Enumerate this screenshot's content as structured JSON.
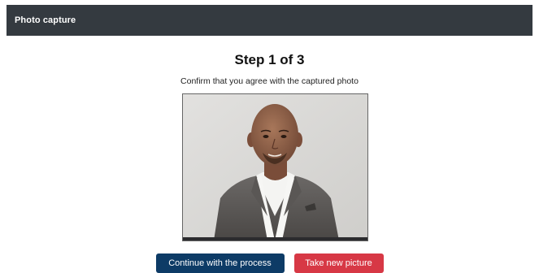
{
  "header": {
    "title": "Photo capture",
    "background_color": "#343a40"
  },
  "main": {
    "step_title": "Step 1 of 3",
    "instruction": "Confirm that you agree with the captured photo",
    "photo": {
      "subject": "captured-portrait-photo"
    }
  },
  "actions": {
    "continue_label": "Continue with the process",
    "continue_color": "#0d3b66",
    "retake_label": "Take new picture",
    "retake_color": "#d73845"
  }
}
